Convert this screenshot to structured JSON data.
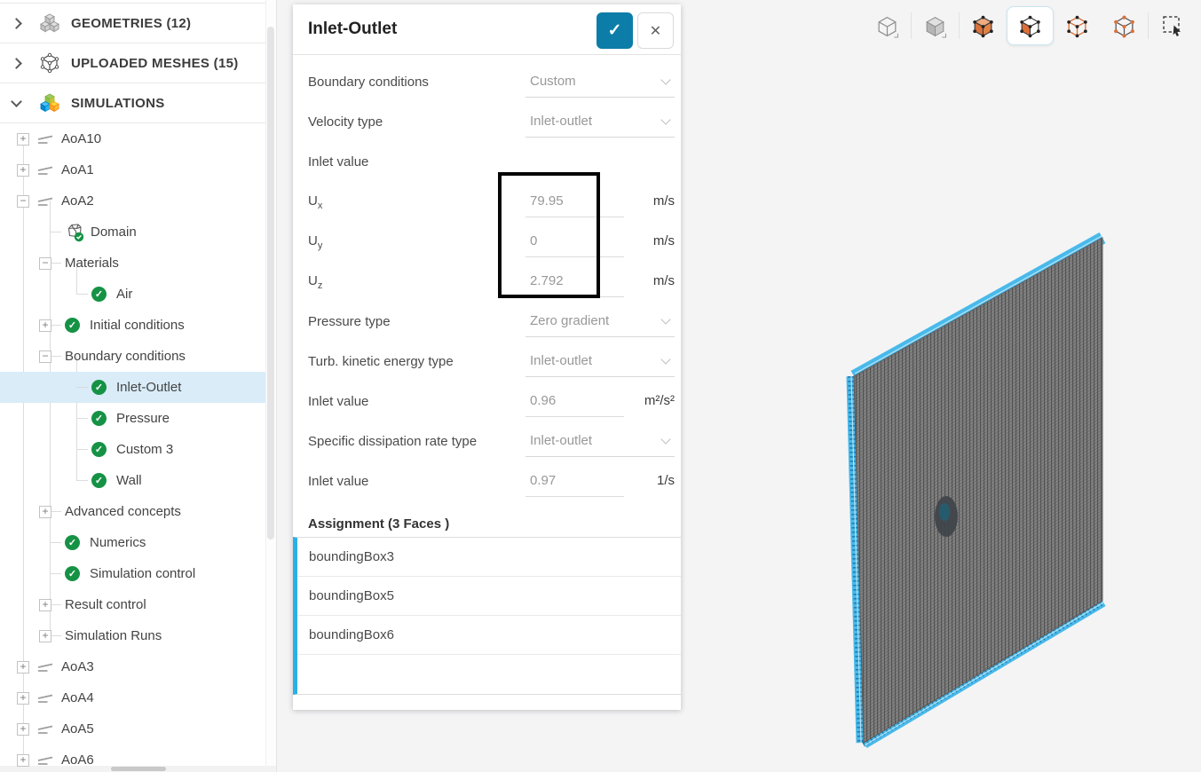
{
  "sidebar": {
    "sections": [
      {
        "label": "GEOMETRIES (12)",
        "icon": "geo",
        "expanded": false
      },
      {
        "label": "UPLOADED MESHES (15)",
        "icon": "mesh",
        "expanded": false
      },
      {
        "label": "SIMULATIONS",
        "icon": "sims",
        "expanded": true
      }
    ],
    "tree": [
      {
        "label": "AoA10",
        "level": 1,
        "expander": "plus",
        "icon": "sim"
      },
      {
        "label": "AoA1",
        "level": 1,
        "expander": "plus",
        "icon": "sim"
      },
      {
        "label": "AoA2",
        "level": 1,
        "expander": "minus",
        "icon": "sim"
      },
      {
        "label": "Domain",
        "level": 2,
        "icon": "domain"
      },
      {
        "label": "Materials",
        "level": 2,
        "expander": "minus"
      },
      {
        "label": "Air",
        "level": 3,
        "check": true
      },
      {
        "label": "Initial conditions",
        "level": 2,
        "expander": "plus",
        "check": true
      },
      {
        "label": "Boundary conditions",
        "level": 2,
        "expander": "minus"
      },
      {
        "label": "Inlet-Outlet",
        "level": 3,
        "check": true,
        "selected": true
      },
      {
        "label": "Pressure",
        "level": 3,
        "check": true
      },
      {
        "label": "Custom 3",
        "level": 3,
        "check": true
      },
      {
        "label": "Wall",
        "level": 3,
        "check": true
      },
      {
        "label": "Advanced concepts",
        "level": 2,
        "expander": "plus"
      },
      {
        "label": "Numerics",
        "level": 2,
        "check": true
      },
      {
        "label": "Simulation control",
        "level": 2,
        "check": true
      },
      {
        "label": "Result control",
        "level": 2,
        "expander": "plus"
      },
      {
        "label": "Simulation Runs",
        "level": 2,
        "expander": "plus"
      },
      {
        "label": "AoA3",
        "level": 1,
        "expander": "plus",
        "icon": "sim"
      },
      {
        "label": "AoA4",
        "level": 1,
        "expander": "plus",
        "icon": "sim"
      },
      {
        "label": "AoA5",
        "level": 1,
        "expander": "plus",
        "icon": "sim"
      },
      {
        "label": "AoA6",
        "level": 1,
        "expander": "plus",
        "icon": "sim"
      }
    ]
  },
  "panel": {
    "title": "Inlet-Outlet",
    "fields": [
      {
        "type": "dropdown",
        "label": "Boundary conditions",
        "value": "Custom"
      },
      {
        "type": "dropdown",
        "label": "Velocity type",
        "value": "Inlet-outlet"
      },
      {
        "type": "heading",
        "label": "Inlet value"
      },
      {
        "type": "input",
        "label": "U",
        "sub": "x",
        "value": "79.95",
        "unit": "m/s",
        "highlighted": true
      },
      {
        "type": "input",
        "label": "U",
        "sub": "y",
        "value": "0",
        "unit": "m/s",
        "highlighted": true
      },
      {
        "type": "input",
        "label": "U",
        "sub": "z",
        "value": "2.792",
        "unit": "m/s",
        "highlighted": true
      },
      {
        "type": "dropdown",
        "label": "Pressure type",
        "value": "Zero gradient"
      },
      {
        "type": "dropdown",
        "label": "Turb. kinetic energy type",
        "value": "Inlet-outlet"
      },
      {
        "type": "input",
        "label": "Inlet value",
        "value": "0.96",
        "unit": "m²/s²"
      },
      {
        "type": "dropdown",
        "label": "Specific dissipation rate type",
        "value": "Inlet-outlet"
      },
      {
        "type": "input",
        "label": "Inlet value",
        "value": "0.97",
        "unit": "1/s"
      }
    ],
    "assignment": {
      "header": "Assignment (3 Faces )",
      "faces": [
        "boundingBox3",
        "boundingBox5",
        "boundingBox6"
      ]
    }
  },
  "viewport": {
    "toolbar": [
      {
        "name": "wireframe-view-tool"
      },
      {
        "name": "solid-view-tool"
      },
      {
        "name": "volume-select-tool"
      },
      {
        "name": "face-select-tool",
        "selected": true
      },
      {
        "name": "edge-select-tool"
      },
      {
        "name": "vertex-select-tool"
      },
      {
        "name": "box-select-tool"
      }
    ]
  },
  "colors": {
    "confirm_button_blue": "#0c7da8",
    "check_green": "#169245",
    "selected_row_bg": "#d9ecf8",
    "assignment_accent": "#2bb0e6",
    "mesh_edge_highlight": "#49b9ea",
    "mesh_face_gray": "#818181",
    "tool_accent_orange": "#dd7038"
  }
}
